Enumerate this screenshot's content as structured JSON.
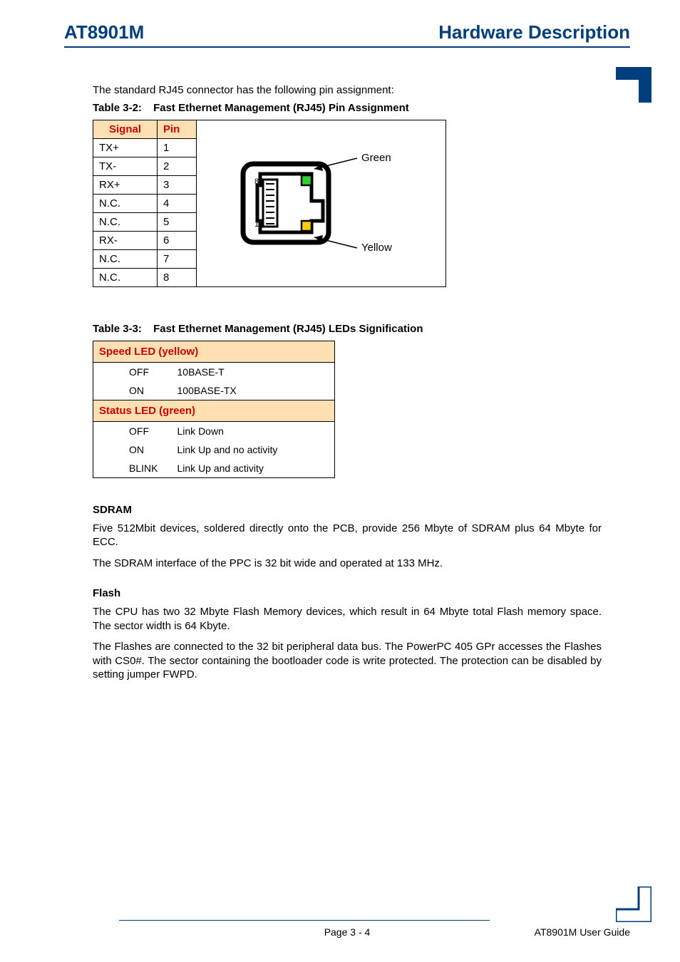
{
  "header": {
    "left": "AT8901M",
    "right": "Hardware Description"
  },
  "intro": "The standard RJ45 connector has the following pin assignment:",
  "table32": {
    "label": "Table 3-2:",
    "title": "Fast Ethernet Management (RJ45) Pin Assignment",
    "head_signal": "Signal",
    "head_pin": "Pin",
    "rows": [
      {
        "signal": "TX+",
        "pin": "1"
      },
      {
        "signal": "TX-",
        "pin": "2"
      },
      {
        "signal": "RX+",
        "pin": "3"
      },
      {
        "signal": "N.C.",
        "pin": "4"
      },
      {
        "signal": "N.C.",
        "pin": "5"
      },
      {
        "signal": "RX-",
        "pin": "6"
      },
      {
        "signal": "N.C.",
        "pin": "7"
      },
      {
        "signal": "N.C.",
        "pin": "8"
      }
    ],
    "diagram": {
      "green_label": "Green",
      "yellow_label": "Yellow",
      "pin8": "8",
      "pin1": "1"
    }
  },
  "table33": {
    "label": "Table 3-3:",
    "title": "Fast Ethernet Management (RJ45) LEDs Signification",
    "speed_header": "Speed LED (yellow)",
    "status_header": "Status LED (green)",
    "speed_rows": [
      {
        "state": "OFF",
        "meaning": "10BASE-T"
      },
      {
        "state": "ON",
        "meaning": "100BASE-TX"
      }
    ],
    "status_rows": [
      {
        "state": "OFF",
        "meaning": "Link Down"
      },
      {
        "state": "ON",
        "meaning": "Link Up and no activity"
      },
      {
        "state": "BLINK",
        "meaning": "Link Up and activity"
      }
    ]
  },
  "sdram": {
    "heading": "SDRAM",
    "p1": "Five 512Mbit devices, soldered directly onto the PCB, provide 256 Mbyte of SDRAM plus 64 Mbyte for ECC.",
    "p2": "The SDRAM interface of the PPC is 32 bit wide and operated at 133 MHz."
  },
  "flash": {
    "heading": "Flash",
    "p1": "The CPU has two 32 Mbyte Flash Memory devices, which result in 64 Mbyte total Flash memory space. The sector width is 64 Kbyte.",
    "p2": "The Flashes are connected to the 32 bit peripheral data bus. The PowerPC 405 GPr accesses the Flashes with CS0#. The sector containing the bootloader code is write protected. The protection can be disabled by setting jumper FWPD."
  },
  "footer": {
    "page": "Page 3 - 4",
    "guide": "AT8901M User Guide"
  }
}
